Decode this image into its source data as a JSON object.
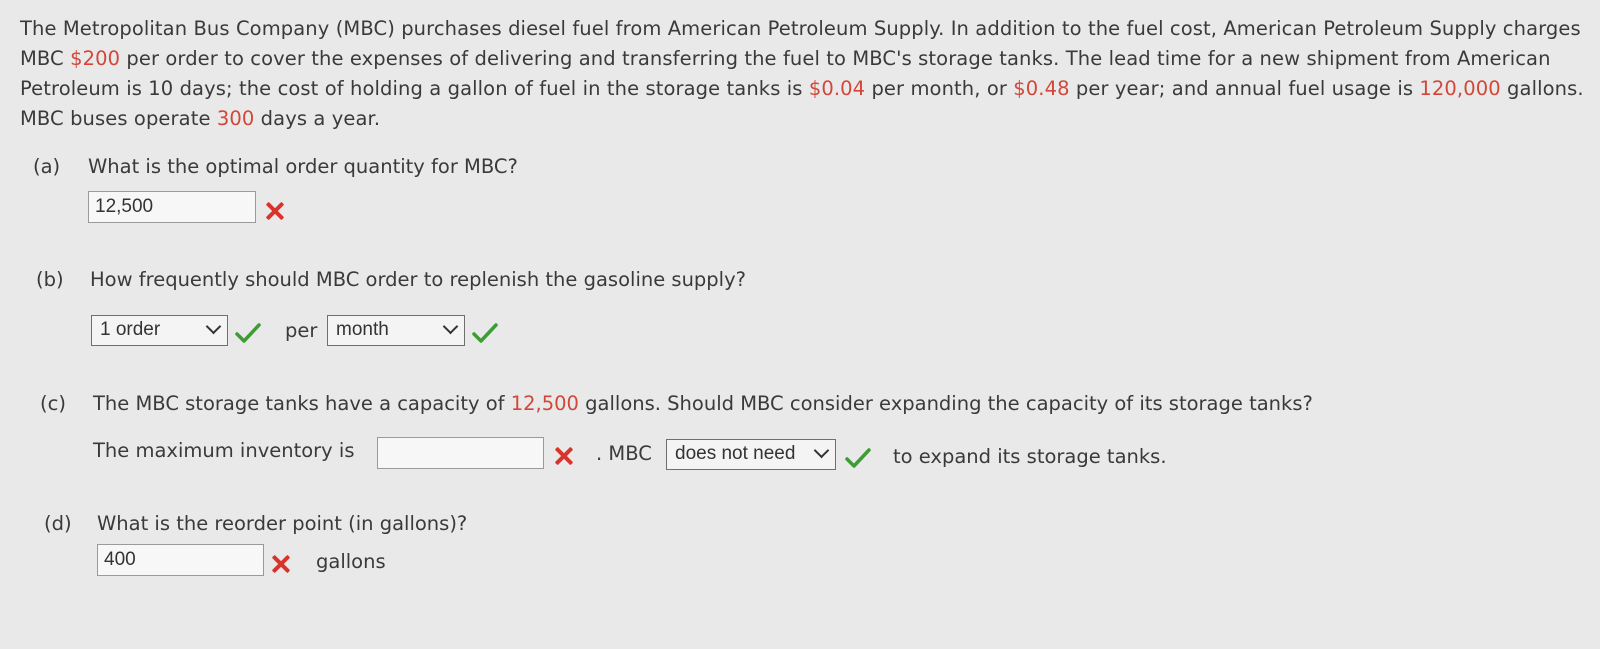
{
  "intro": {
    "p1": "The Metropolitan Bus Company (MBC) purchases diesel fuel from American Petroleum Supply. In addition to the fuel cost, American Petroleum Supply charges MBC ",
    "order_cost": "$200",
    "p2": " per order to cover the expenses of delivering and transferring the fuel to MBC's storage tanks. The lead time for a new shipment from American Petroleum is 10 days; the cost of holding a gallon of fuel in the storage tanks is ",
    "hold_month": "$0.04",
    "p3": " per month, or ",
    "hold_year": "$0.48",
    "p4": " per year; and annual fuel usage is ",
    "usage": "120,000",
    "p5": " gallons. MBC buses operate ",
    "days": "300",
    "p6": " days a year."
  },
  "part_a": {
    "label": "(a)",
    "question": "What is the optimal order quantity for MBC?",
    "answer": "12,500"
  },
  "part_b": {
    "label": "(b)",
    "question": "How frequently should MBC order to replenish the gasoline supply?",
    "select1": "1 order",
    "per": "per",
    "select2": "month"
  },
  "part_c": {
    "label": "(c)",
    "q1": "The MBC storage tanks have a capacity of ",
    "capacity": "12,500",
    "q2": " gallons. Should MBC consider expanding the capacity of its storage tanks?",
    "max_label": "The maximum inventory is",
    "max_value": "",
    "mbc": ". MBC",
    "select": "does not need",
    "tail": "to expand its storage tanks."
  },
  "part_d": {
    "label": "(d)",
    "question": "What is the reorder point (in gallons)?",
    "answer": "400",
    "unit": "gallons"
  },
  "colors": {
    "highlight": "#d2473a",
    "wrong": "#d9342b",
    "correct": "#3f9c35"
  }
}
